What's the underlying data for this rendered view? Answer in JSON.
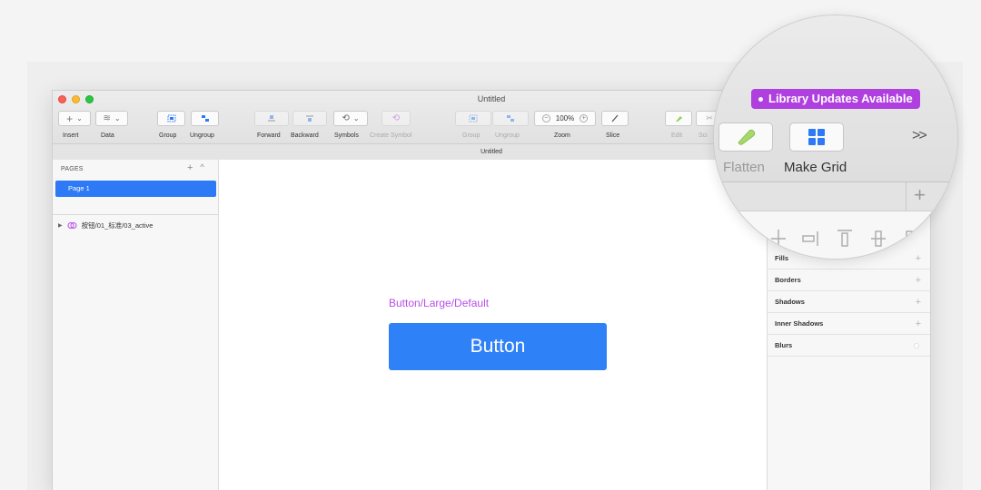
{
  "window": {
    "title": "Untitled",
    "tab_title": "Untitled"
  },
  "toolbar": {
    "insert": {
      "label": "Insert",
      "glyph": "+"
    },
    "data": {
      "label": "Data",
      "glyph": "≋"
    },
    "group": {
      "label": "Group"
    },
    "ungroup": {
      "label": "Ungroup"
    },
    "forward": {
      "label": "Forward"
    },
    "backward": {
      "label": "Backward"
    },
    "symbols": {
      "label": "Symbols",
      "glyph": "⟲"
    },
    "create_symbol": {
      "label": "Create Symbol",
      "glyph": "⟲"
    },
    "group2": {
      "label": "Group"
    },
    "ungroup2": {
      "label": "Ungroup"
    },
    "zoom": {
      "label": "Zoom",
      "value": "100%",
      "minus": "−",
      "plus": "+"
    },
    "slice": {
      "label": "Slice"
    },
    "edit": {
      "label": "Edit"
    },
    "scissors": {
      "label": "Sci"
    },
    "dropdown_glyph": "⌄"
  },
  "pages": {
    "header": "PAGES",
    "add_glyph": "+",
    "collapse_glyph": "^",
    "items": [
      {
        "label": "Page 1",
        "selected": true
      }
    ]
  },
  "layers": [
    {
      "label": "按钮/01_标准/03_active",
      "expand_glyph": "▶"
    }
  ],
  "canvas": {
    "artboard_label": "Button/Large/Default",
    "button_text": "Button",
    "label_color": "#b84ee6",
    "button_color": "#2f81f7"
  },
  "inspector": {
    "sections": [
      {
        "label": "Fills",
        "action": "+"
      },
      {
        "label": "Borders",
        "action": "+"
      },
      {
        "label": "Shadows",
        "action": "+"
      },
      {
        "label": "Inner Shadows",
        "action": "+"
      },
      {
        "label": "Blurs",
        "action": ""
      }
    ]
  },
  "magnifier": {
    "badge": "Library Updates Available",
    "badge_color": "#b03fe0",
    "flatten_label": "Flatten",
    "make_grid_label": "Make Grid",
    "more_glyph": ">>",
    "add_glyph": "+"
  }
}
